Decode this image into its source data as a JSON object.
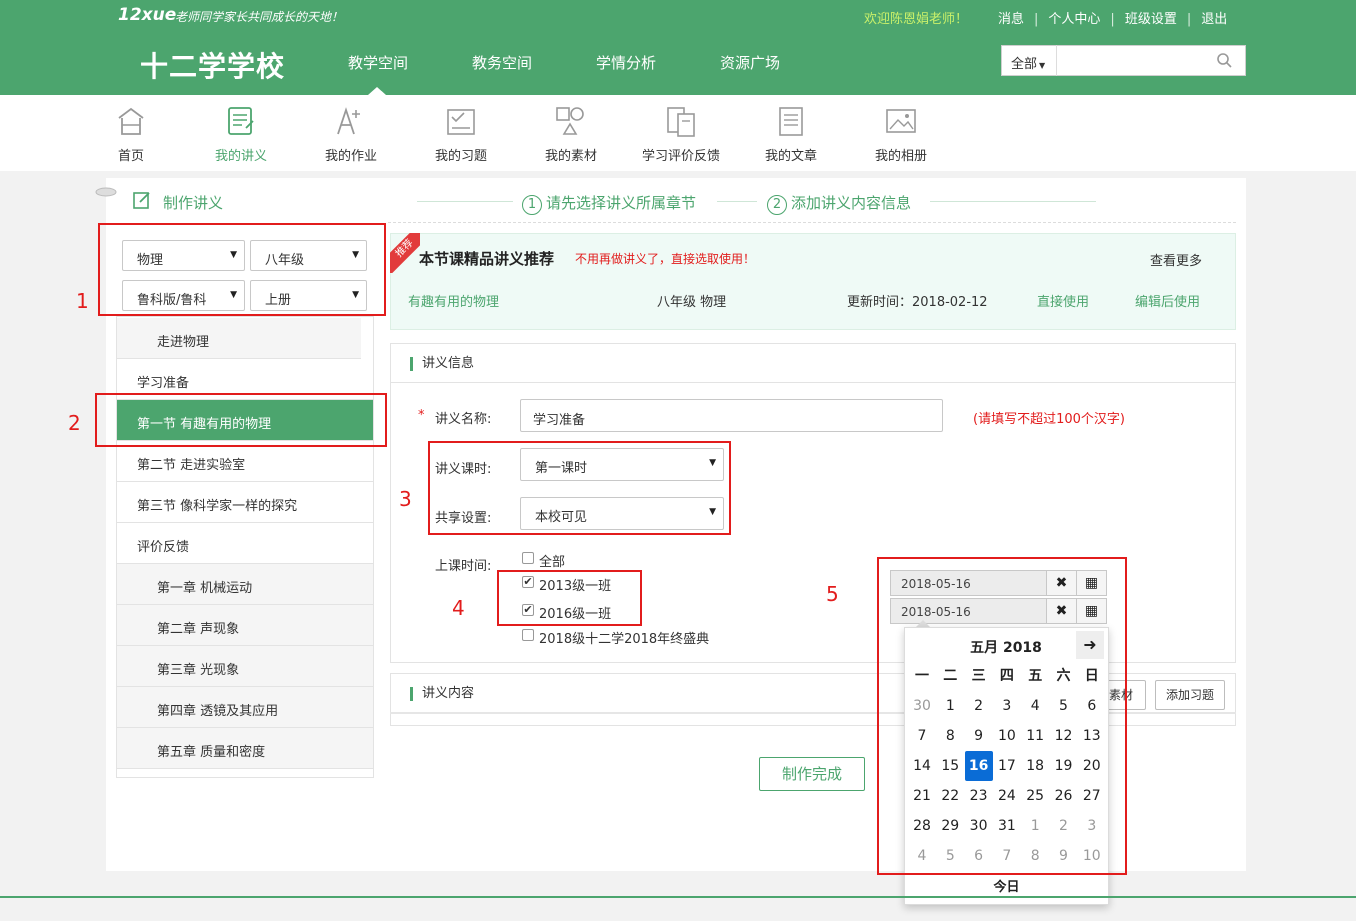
{
  "topbar": {
    "logo": "12xue",
    "slogan": "老师同学家长共同成长的天地！",
    "welcome": "欢迎陈恩娟老师！",
    "links": [
      "消息",
      "个人中心",
      "班级设置",
      "退出"
    ]
  },
  "nav": {
    "school": "十二学学校",
    "items": [
      "教学空间",
      "教务空间",
      "学情分析",
      "资源广场"
    ],
    "search_scope": "全部",
    "search_value": ""
  },
  "iconbar": {
    "items": [
      {
        "label": "首页",
        "icon": "home-icon"
      },
      {
        "label": "我的讲义",
        "icon": "notes-icon"
      },
      {
        "label": "我的作业",
        "icon": "homework-icon"
      },
      {
        "label": "我的习题",
        "icon": "exercise-icon"
      },
      {
        "label": "我的素材",
        "icon": "material-icon"
      },
      {
        "label": "学习评价反馈",
        "icon": "feedback-icon"
      },
      {
        "label": "我的文章",
        "icon": "article-icon"
      },
      {
        "label": "我的相册",
        "icon": "album-icon"
      }
    ]
  },
  "page": {
    "title": "制作讲义",
    "steps": [
      {
        "num": "1",
        "label": "请先选择讲义所属章节"
      },
      {
        "num": "2",
        "label": "添加讲义内容信息"
      }
    ]
  },
  "annotations": [
    "1",
    "2",
    "3",
    "4",
    "5"
  ],
  "filters": {
    "subject": "物理",
    "grade": "八年级",
    "edition": "鲁科版/鲁科",
    "volume": "上册"
  },
  "sidebar": {
    "items": [
      {
        "label": "走进物理",
        "sub": true
      },
      {
        "label": "学习准备",
        "sub": false
      },
      {
        "label": "第一节 有趣有用的物理",
        "sub": false,
        "active": true
      },
      {
        "label": "第二节 走进实验室",
        "sub": false
      },
      {
        "label": "第三节 像科学家一样的探究",
        "sub": false
      },
      {
        "label": "评价反馈",
        "sub": false
      },
      {
        "label": "第一章 机械运动",
        "sub": true
      },
      {
        "label": "第二章 声现象",
        "sub": true
      },
      {
        "label": "第三章 光现象",
        "sub": true
      },
      {
        "label": "第四章 透镜及其应用",
        "sub": true
      },
      {
        "label": "第五章 质量和密度",
        "sub": true
      }
    ]
  },
  "recommend": {
    "ribbon": "推荐",
    "title": "本节课精品讲义推荐",
    "note": "不用再做讲义了，直接选取使用！",
    "more": "查看更多",
    "row": {
      "name": "有趣有用的物理",
      "grade_subject": "八年级 物理",
      "updated": "更新时间：2018-02-12",
      "use": "直接使用",
      "edit": "编辑后使用"
    }
  },
  "info": {
    "section_title": "讲义信息",
    "required_mark": "*",
    "name_label": "讲义名称:",
    "name_value": "学习准备",
    "name_hint": "(请填写不超过100个汉字)",
    "period_label": "讲义课时:",
    "period_value": "第一课时",
    "share_label": "共享设置:",
    "share_value": "本校可见",
    "time_label": "上课时间:",
    "classes": [
      {
        "label": "全部",
        "checked": false
      },
      {
        "label": "2013级一班",
        "checked": true
      },
      {
        "label": "2016级一班",
        "checked": true
      },
      {
        "label": "2018级十二学2018年终盛典",
        "checked": false
      }
    ],
    "dates": [
      "2018-05-16",
      "2018-05-16"
    ]
  },
  "content": {
    "section_title": "讲义内容",
    "btn_material": "素材",
    "btn_exercise": "添加习题",
    "done": "制作完成"
  },
  "calendar": {
    "title": "五月 2018",
    "weekdays": [
      "一",
      "二",
      "三",
      "四",
      "五",
      "六",
      "日"
    ],
    "weeks": [
      [
        30,
        1,
        2,
        3,
        4,
        5,
        6
      ],
      [
        7,
        8,
        9,
        10,
        11,
        12,
        13
      ],
      [
        14,
        15,
        16,
        17,
        18,
        19,
        20
      ],
      [
        21,
        22,
        23,
        24,
        25,
        26,
        27
      ],
      [
        28,
        29,
        30,
        31,
        1,
        2,
        3
      ],
      [
        4,
        5,
        6,
        7,
        8,
        9,
        10
      ]
    ],
    "selected": 16,
    "today": "今日"
  }
}
